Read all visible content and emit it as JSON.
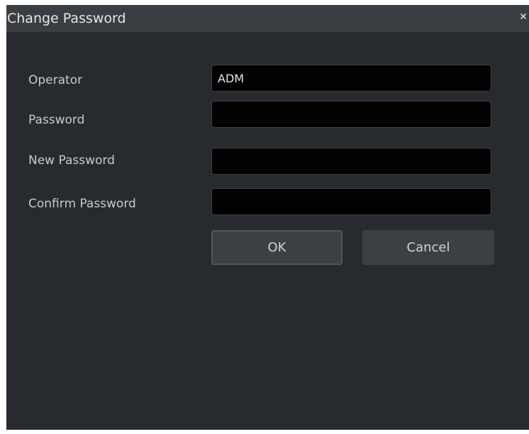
{
  "dialog": {
    "title": "Change Password",
    "close_glyph": "×"
  },
  "fields": {
    "operator": {
      "label": "Operator",
      "value": "ADM"
    },
    "password": {
      "label": "Password",
      "value": ""
    },
    "new_password": {
      "label": "New Password",
      "value": ""
    },
    "confirm_password": {
      "label": "Confirm Password",
      "value": ""
    }
  },
  "buttons": {
    "ok_label": "OK",
    "cancel_label": "Cancel"
  },
  "colors": {
    "dialog_background": "#272b2f",
    "title_bar": "#3a3e43",
    "input_background": "#020202",
    "button_background": "#3b4045"
  },
  "icons": {
    "close": "close-icon"
  }
}
